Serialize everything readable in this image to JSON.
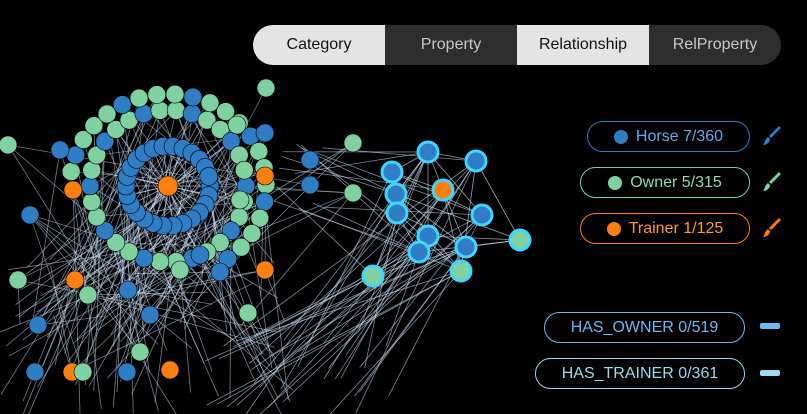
{
  "tabs": [
    {
      "label": "Category",
      "selected": true
    },
    {
      "label": "Property",
      "selected": false
    },
    {
      "label": "Relationship",
      "selected": true
    },
    {
      "label": "RelProperty",
      "selected": false
    }
  ],
  "node_legend": [
    {
      "label": "Horse 7/360",
      "color": "#2f7dc4",
      "text_color": "#6aa9e8",
      "icon": "paint-brush-icon"
    },
    {
      "label": "Owner 5/315",
      "color": "#7fd19f",
      "text_color": "#8fdcb0",
      "icon": "paint-brush-icon"
    },
    {
      "label": "Trainer 1/125",
      "color": "#ff7f0e",
      "text_color": "#ff9a3a",
      "icon": "paint-brush-icon"
    }
  ],
  "rel_legend": [
    {
      "label": "HAS_OWNER 0/519",
      "color": "#6fb8f0"
    },
    {
      "label": "HAS_TRAINER 0/361",
      "color": "#9ed8f2"
    }
  ],
  "colors": {
    "horse": "#2f7dc4",
    "owner": "#7fd19f",
    "trainer": "#ff7f0e",
    "highlight_ring": "#3fd6ff",
    "edge": "#cfe6ff"
  }
}
